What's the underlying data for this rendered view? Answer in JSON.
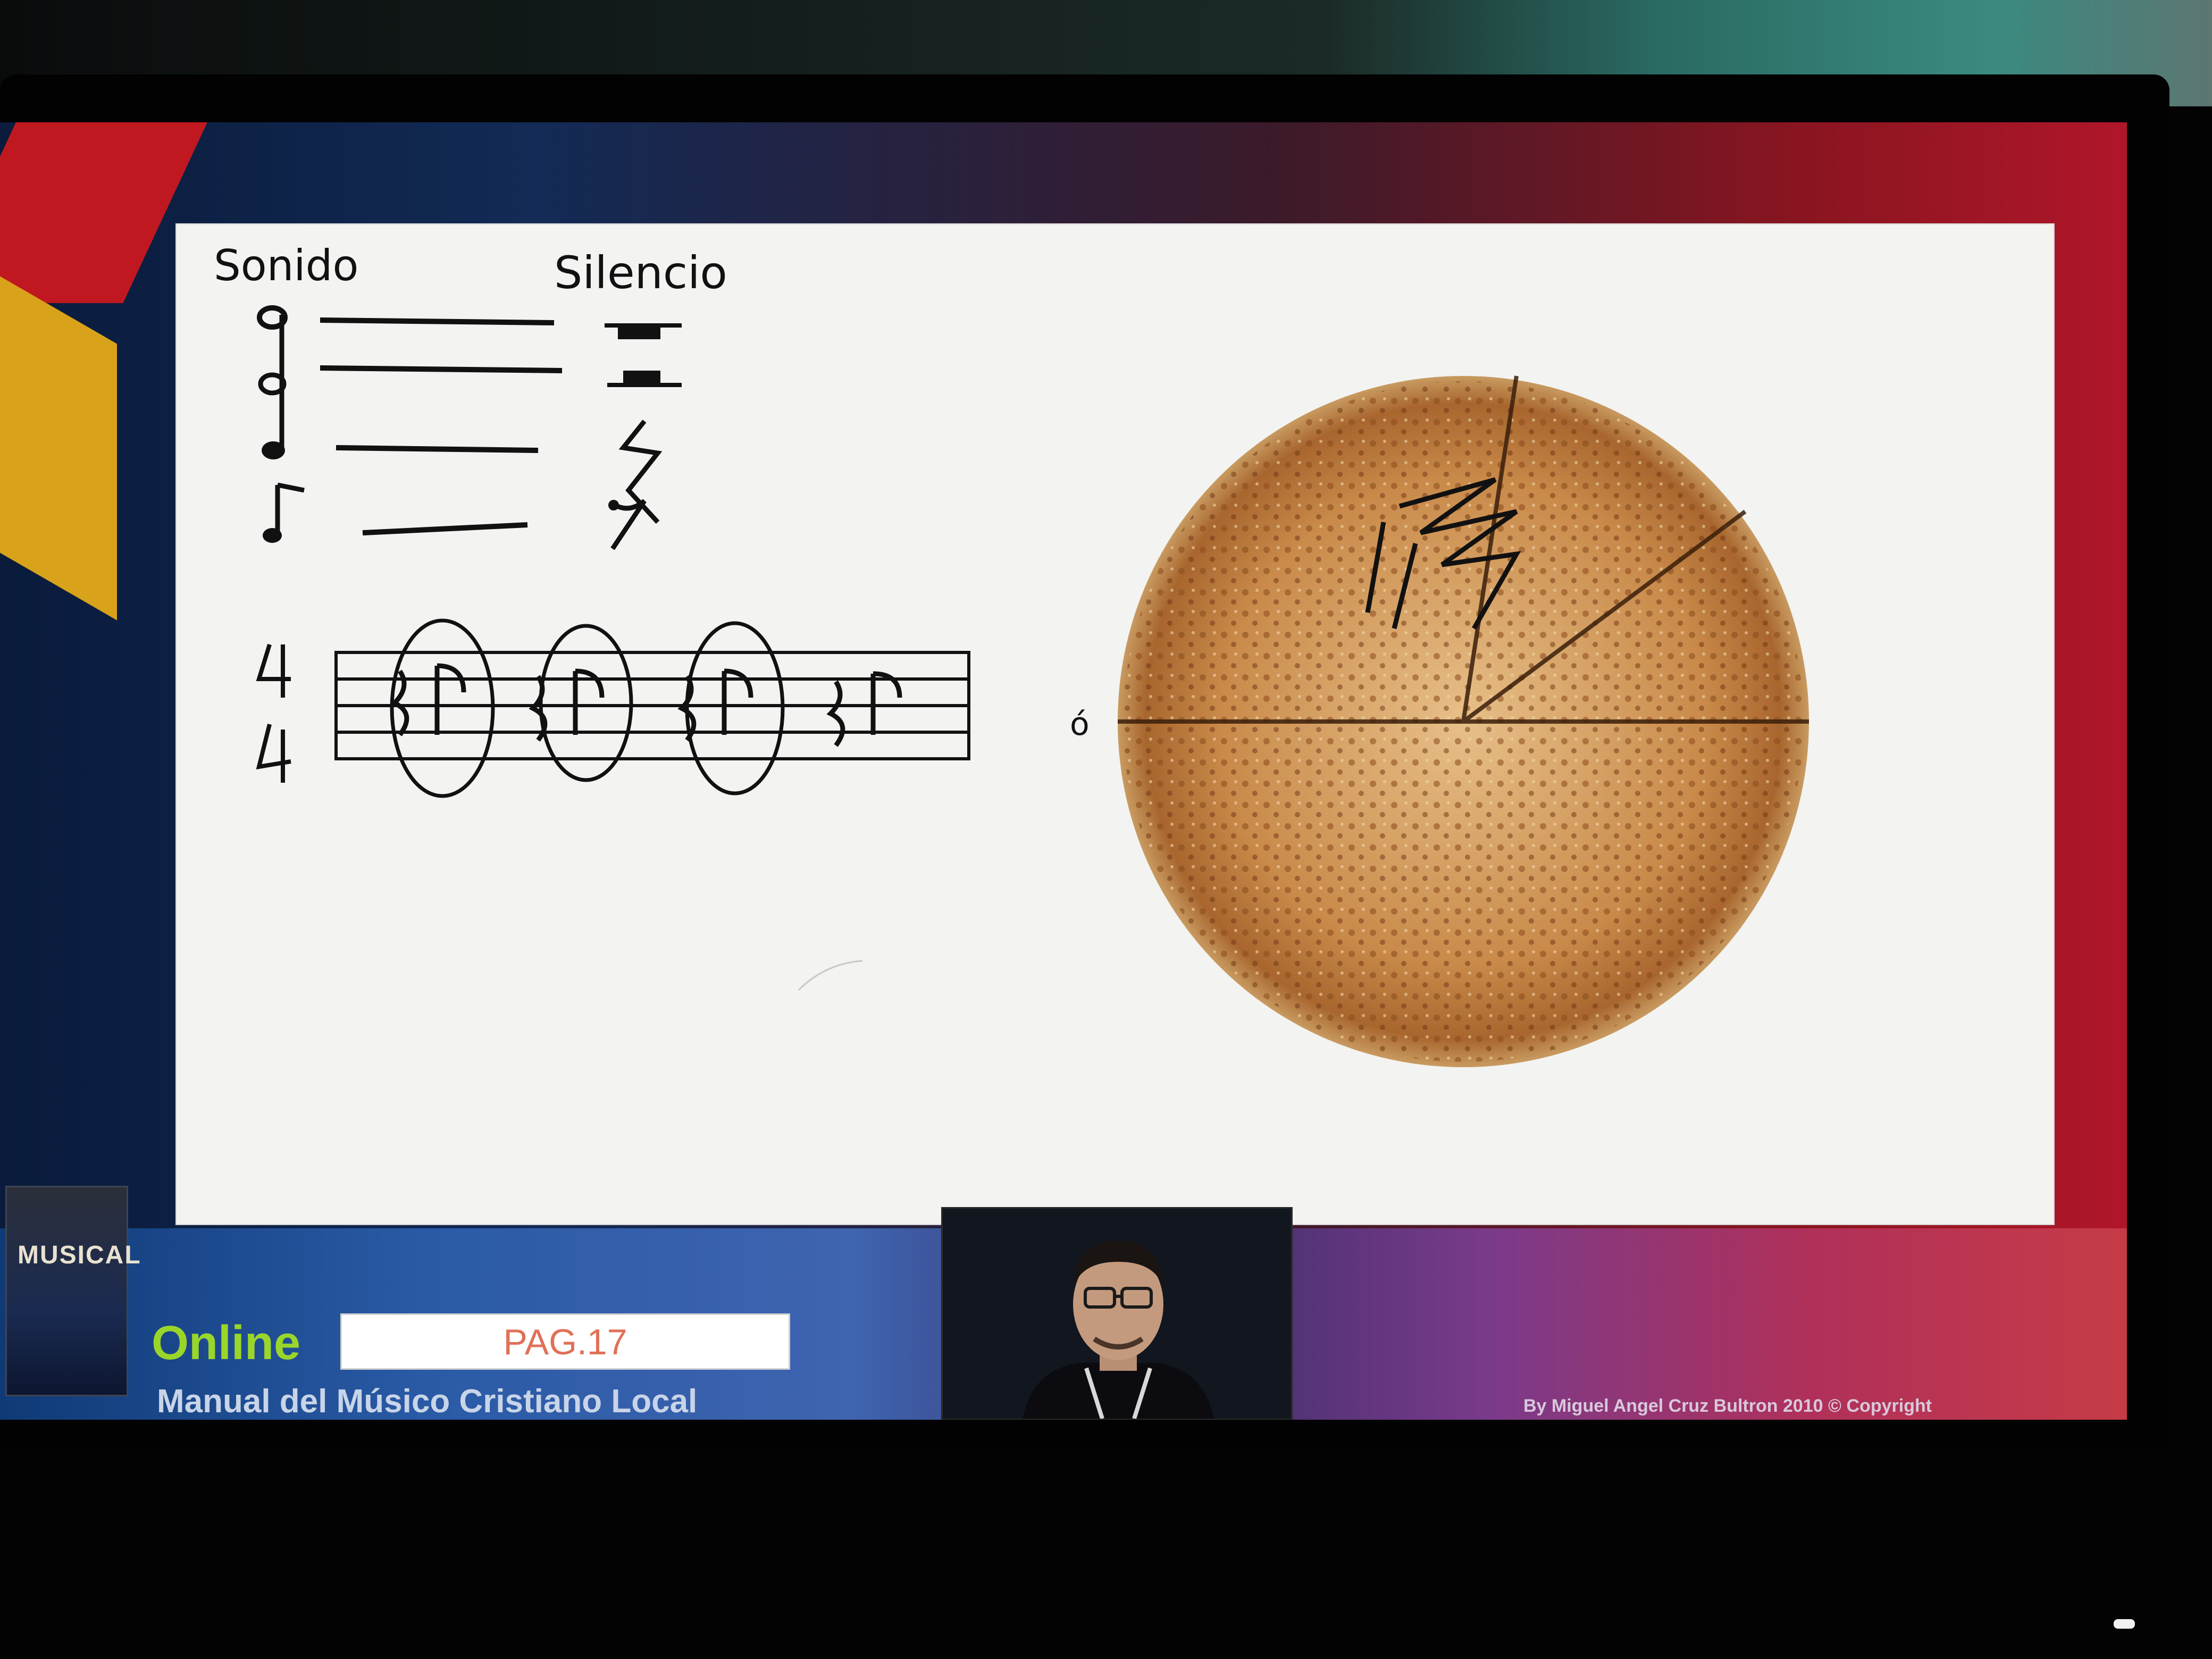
{
  "board": {
    "heading_sound": "Sonido",
    "heading_silence": "Silencio",
    "separator": "ó"
  },
  "footer": {
    "online_label": "Online",
    "page_label": "PAG.17",
    "manual_title": "Manual del Músico Cristiano Local",
    "credit": "By Miguel Angel Cruz Bultron 2010 © Copyright",
    "book_cover_text": "MUSICAL"
  },
  "colors": {
    "online": "#9ad62a",
    "page_label": "#e07058",
    "ink": "#111111"
  }
}
